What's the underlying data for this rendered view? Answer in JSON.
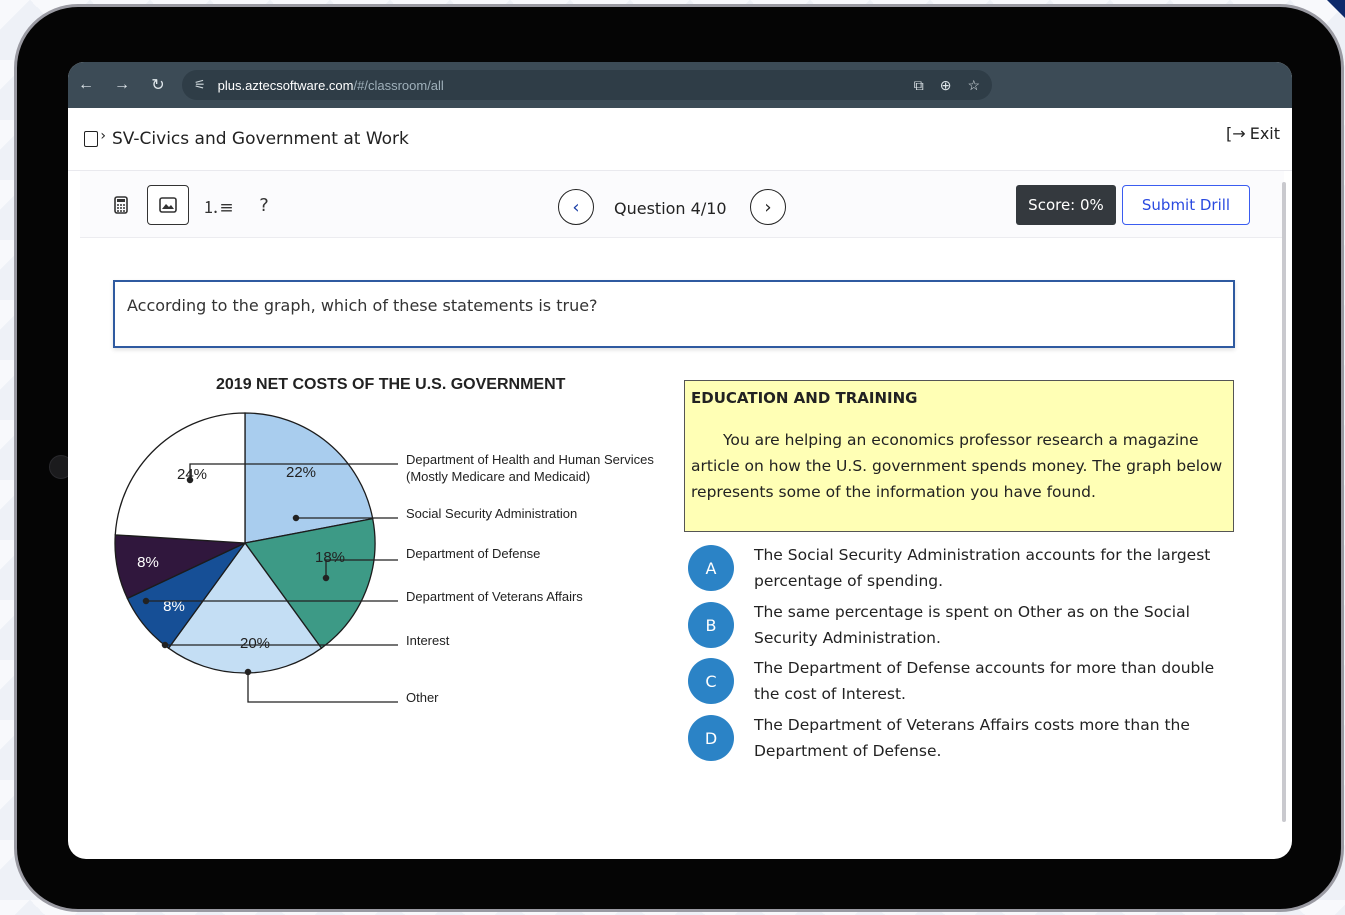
{
  "browser": {
    "url_host": "plus.aztecsoftware.com",
    "url_path": "/#/classroom/all"
  },
  "app": {
    "title": "SV-Civics and Government at Work",
    "exit_label": "Exit"
  },
  "toolbar": {
    "help_label": "?",
    "question_label": "Question 4/10",
    "score_label": "Score: 0%",
    "submit_label": "Submit Drill"
  },
  "question": {
    "prompt": "According to the graph, which of these statements is true?"
  },
  "chart_data": {
    "type": "pie",
    "title": "2019 NET COSTS OF THE U.S. GOVERNMENT",
    "slices": [
      {
        "label": "Department of Health and Human Services",
        "sublabel": "(Mostly Medicare and Medicaid)",
        "value": 22,
        "text": "22%",
        "color": "#a9cdee"
      },
      {
        "label": "Department of Defense",
        "value": 18,
        "text": "18%",
        "color": "#3d9a86"
      },
      {
        "label": "Social Security Administration",
        "value": 20,
        "text": "20%",
        "color": "#c4def4"
      },
      {
        "label": "Department of Veterans Affairs",
        "value": 8,
        "text": "8%",
        "color": "#164f96"
      },
      {
        "label": "Interest",
        "value": 8,
        "text": "8%",
        "color": "#30173d"
      },
      {
        "label": "Other",
        "value": 24,
        "text": "24%",
        "color": "#ffffff"
      }
    ],
    "legend": [
      {
        "line1": "Department of Health and Human Services",
        "line2": "(Mostly Medicare and Medicaid)"
      },
      {
        "line1": "Social Security Administration"
      },
      {
        "line1": "Department of Defense"
      },
      {
        "line1": "Department of Veterans Affairs"
      },
      {
        "line1": "Interest"
      },
      {
        "line1": "Other"
      }
    ]
  },
  "passage": {
    "title": "EDUCATION AND TRAINING",
    "body": "You are helping an economics professor research a magazine article on how the U.S. government spends money. The graph below represents some of the information you have found."
  },
  "options": [
    {
      "letter": "A",
      "text": "The Social Security Administration accounts for the largest percentage of spending."
    },
    {
      "letter": "B",
      "text": "The same percentage is spent on Other as on the Social Security Administration."
    },
    {
      "letter": "C",
      "text": "The Department of Defense accounts for more than double the cost of Interest."
    },
    {
      "letter": "D",
      "text": "The Department of Veterans Affairs costs more than the Department of Defense."
    }
  ]
}
